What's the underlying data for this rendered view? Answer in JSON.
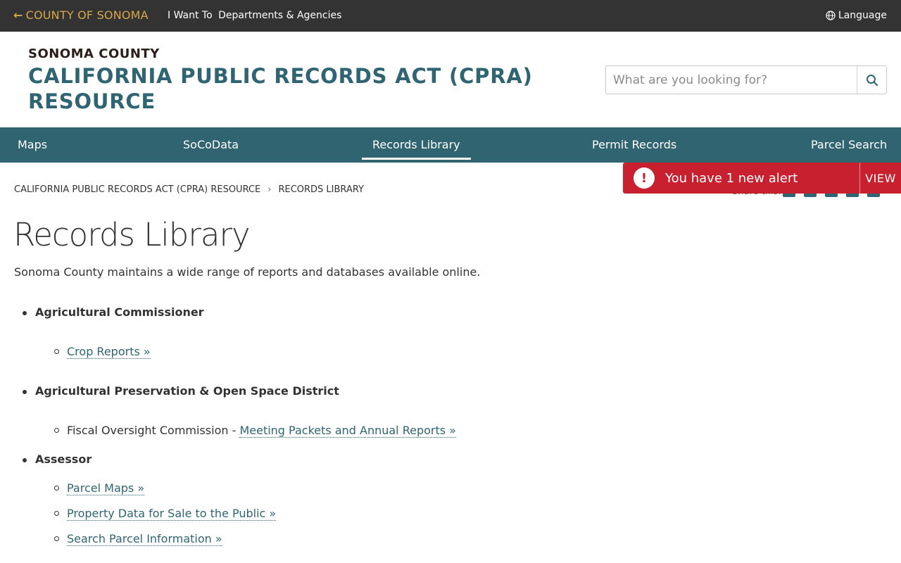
{
  "topbar": {
    "county_link": "COUNTY OF SONOMA",
    "i_want_to": "I Want To",
    "departments": "Departments & Agencies",
    "language": "Language"
  },
  "header": {
    "subtitle": "SONOMA COUNTY",
    "title": "CALIFORNIA PUBLIC RECORDS ACT (CPRA) RESOURCE",
    "search_placeholder": "What are you looking for?"
  },
  "nav": {
    "items": [
      "Maps",
      "SoCoData",
      "Records Library",
      "Permit Records",
      "Parcel Search"
    ],
    "active": "Records Library"
  },
  "alert": {
    "message": "You have 1 new alert",
    "action": "VIEW",
    "color": "#c8202e"
  },
  "share": {
    "label": "Share this:"
  },
  "breadcrumb": [
    "CALIFORNIA PUBLIC RECORDS ACT (CPRA) RESOURCE",
    "RECORDS LIBRARY"
  ],
  "page": {
    "title": "Records Library",
    "intro": "Sonoma County maintains a wide range of reports and databases available online."
  },
  "sections": [
    {
      "name": "Agricultural Commissioner",
      "links": [
        {
          "prefix": "",
          "text": "Crop Reports »"
        }
      ]
    },
    {
      "name": "Agricultural Preservation & Open Space District",
      "links": [
        {
          "prefix": "Fiscal Oversight Commission - ",
          "text": "Meeting Packets and Annual Reports »"
        }
      ]
    },
    {
      "name": "Assessor",
      "links": [
        {
          "prefix": "",
          "text": "Parcel Maps »"
        },
        {
          "prefix": "",
          "text": "Property Data for Sale to the Public »"
        },
        {
          "prefix": "",
          "text": "Search Parcel Information »"
        }
      ]
    }
  ],
  "colors": {
    "topbar": "#333333",
    "brand_gold": "#d6a84a",
    "brand_teal": "#2f6473",
    "nav_bg": "#2f6470"
  }
}
